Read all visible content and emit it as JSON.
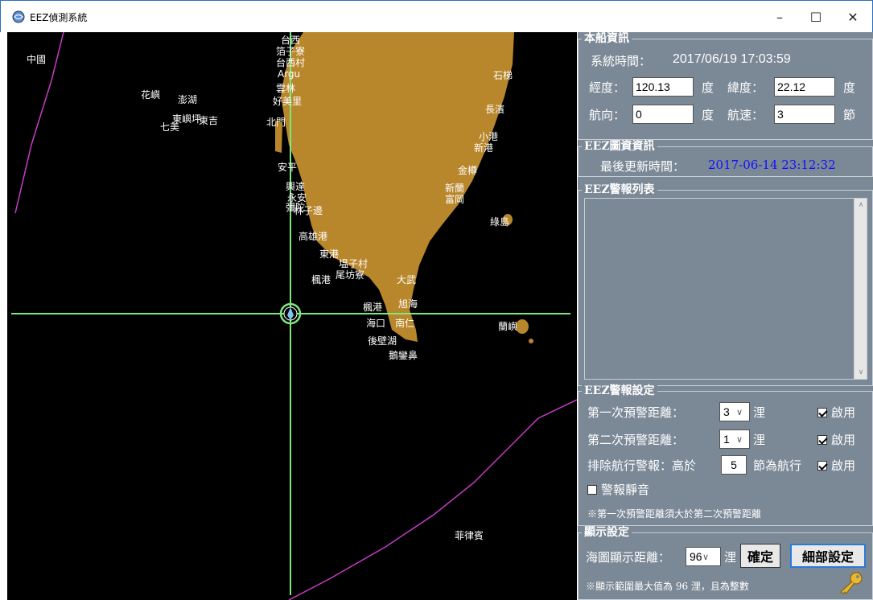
{
  "window": {
    "title": "EEZ偵測系統",
    "minimize": "–",
    "maximize": "☐",
    "close": "✕"
  },
  "map": {
    "places": [
      {
        "text": "中國"
      },
      {
        "text": "花嶼"
      },
      {
        "text": "東嶼坪"
      },
      {
        "text": "東吉"
      },
      {
        "text": "澎湖"
      },
      {
        "text": "七美"
      },
      {
        "text": "台西"
      },
      {
        "text": "箔子寮"
      },
      {
        "text": "台西村"
      },
      {
        "text": "Argu"
      },
      {
        "text": "雲林"
      },
      {
        "text": "好美里"
      },
      {
        "text": "北門"
      },
      {
        "text": "安平"
      },
      {
        "text": "興達"
      },
      {
        "text": "永安"
      },
      {
        "text": "彌陀"
      },
      {
        "text": "林子邊"
      },
      {
        "text": "高雄港"
      },
      {
        "text": "東港"
      },
      {
        "text": "塭子村"
      },
      {
        "text": "楓港"
      },
      {
        "text": "尾坊寮"
      },
      {
        "text": "石梯"
      },
      {
        "text": "長濱"
      },
      {
        "text": "小港"
      },
      {
        "text": "新港"
      },
      {
        "text": "金樽"
      },
      {
        "text": "新蘭"
      },
      {
        "text": "富岡"
      },
      {
        "text": "綠島"
      },
      {
        "text": "大武"
      },
      {
        "text": "旭海"
      },
      {
        "text": "楓港"
      },
      {
        "text": "南仁"
      },
      {
        "text": "海口"
      },
      {
        "text": "後壁湖"
      },
      {
        "text": "鵝鑾鼻"
      },
      {
        "text": "蘭嶼"
      },
      {
        "text": "菲律賓"
      }
    ]
  },
  "ship_info": {
    "section_title": "本船資訊",
    "system_time_label": "系統時間：",
    "system_time_value": "2017/06/19 17:03:59",
    "longitude_label": "經度：",
    "longitude_value": "120.13",
    "longitude_unit": "度",
    "latitude_label": "緯度：",
    "latitude_value": "22.12",
    "latitude_unit": "度",
    "heading_label": "航向：",
    "heading_value": "0",
    "heading_unit": "度",
    "speed_label": "航速：",
    "speed_value": "3",
    "speed_unit": "節"
  },
  "eez_map_info": {
    "section_title": "EEZ圖資資訊",
    "last_update_label": "最後更新時間：",
    "last_update_value": "2017-06-14 23:12:32"
  },
  "eez_alert_list": {
    "section_title": "EEZ警報列表",
    "scroll_up": "∧",
    "scroll_down": "∨"
  },
  "eez_alert_settings": {
    "section_title": "EEZ警報設定",
    "first_label": "第一次預警距離：",
    "first_value": "3",
    "first_unit": "浬",
    "first_enable": "啟用",
    "second_label": "第二次預警距離：",
    "second_value": "1",
    "second_unit": "浬",
    "second_enable": "啟用",
    "exclude_label": "排除航行警報：高於",
    "exclude_value": "5",
    "exclude_suffix": "節為航行",
    "exclude_enable": "啟用",
    "mute_label": "警報靜音",
    "note": "※第一次預警距離須大於第二次預警距離"
  },
  "display_settings": {
    "section_title": "顯示設定",
    "distance_label": "海圖顯示距離：",
    "distance_value": "96",
    "distance_unit": "浬",
    "confirm_button": "確定",
    "detail_button": "細部設定",
    "note": "※顯示範圍最大值為 96 浬，且為整數"
  },
  "colors": {
    "land": "#b8862b",
    "crosshair": "#7ee87e",
    "eez_line": "#c83cc8",
    "panel_bg": "#7b8896",
    "update_time": "#1010ff"
  }
}
